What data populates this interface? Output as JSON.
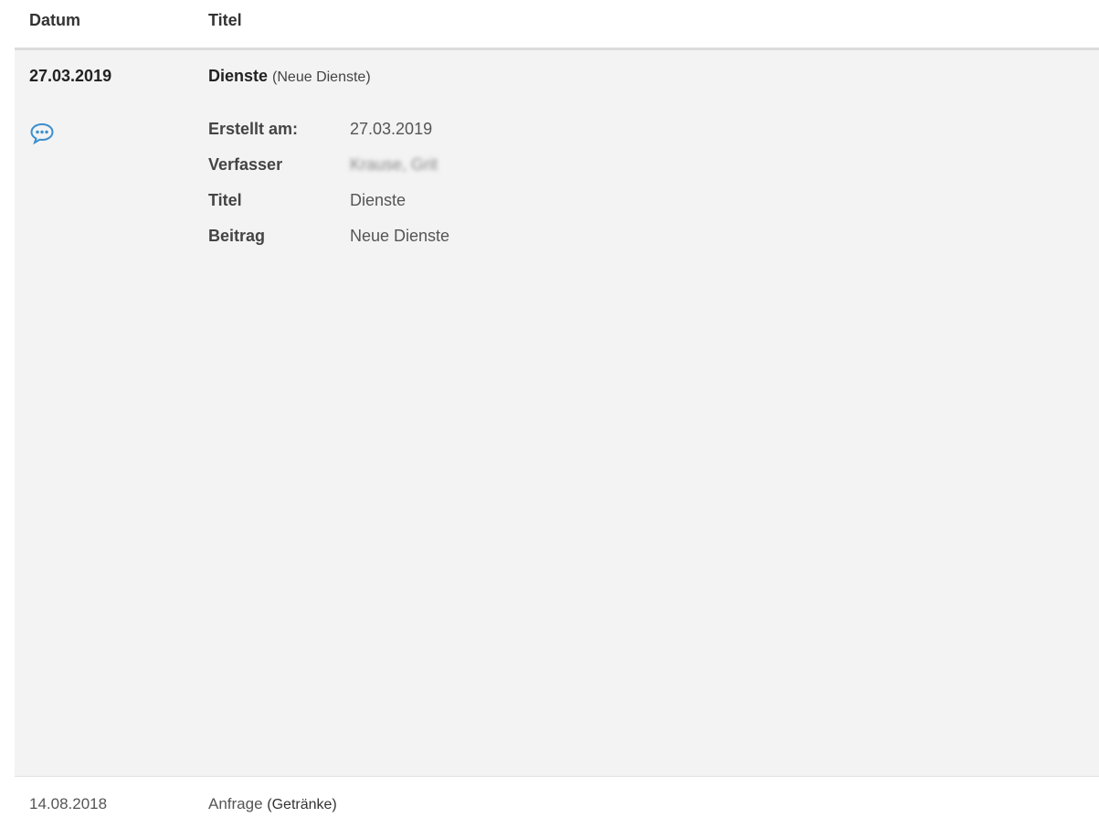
{
  "header": {
    "date_label": "Datum",
    "title_label": "Titel"
  },
  "entries": [
    {
      "date": "27.03.2019",
      "title": "Dienste",
      "subtitle": "(Neue Dienste)",
      "icon": "comment-icon",
      "details": [
        {
          "label": "Erstellt am:",
          "value": "27.03.2019"
        },
        {
          "label": "Verfasser",
          "value": "Krause, Grit"
        },
        {
          "label": "Titel",
          "value": "Dienste"
        },
        {
          "label": "Beitrag",
          "value": "Neue Dienste"
        }
      ]
    },
    {
      "date": "14.08.2018",
      "title": "Anfrage",
      "subtitle": "(Getränke)"
    }
  ],
  "colors": {
    "icon": "#3a8fd0",
    "row_background": "#f3f3f3",
    "header_border": "#dcdcdc"
  }
}
